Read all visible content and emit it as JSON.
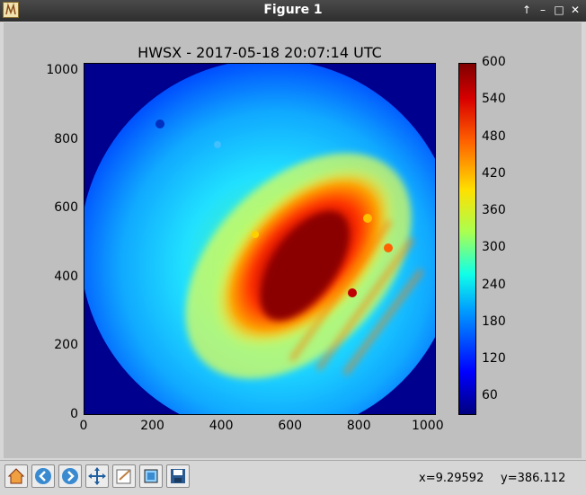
{
  "window": {
    "title": "Figure 1",
    "buttons": [
      "↑",
      "–",
      "□",
      "✕"
    ]
  },
  "plot": {
    "title": "HWSX - 2017-05-18 20:07:14 UTC",
    "x_ticks": [
      "0",
      "200",
      "400",
      "600",
      "800",
      "1000"
    ],
    "y_ticks": [
      "0",
      "200",
      "400",
      "600",
      "800",
      "1000"
    ],
    "colorbar_ticks": [
      "60",
      "120",
      "180",
      "240",
      "300",
      "360",
      "420",
      "480",
      "540",
      "600"
    ]
  },
  "chart_data": {
    "type": "heatmap",
    "title": "HWSX - 2017-05-18 20:07:14 UTC",
    "xlim": [
      0,
      1024
    ],
    "ylim": [
      0,
      1024
    ],
    "colorbar": {
      "min": 30,
      "max": 600,
      "colormap": "jet",
      "ticks": [
        60,
        120,
        180,
        240,
        300,
        360,
        420,
        480,
        540,
        600
      ]
    }
  },
  "toolbar": {
    "icons": [
      "home-icon",
      "back-icon",
      "forward-icon",
      "pan-icon",
      "configure-icon",
      "subplots-icon",
      "save-icon"
    ],
    "coords_x": "x=9.29592",
    "coords_y": "y=386.112"
  }
}
